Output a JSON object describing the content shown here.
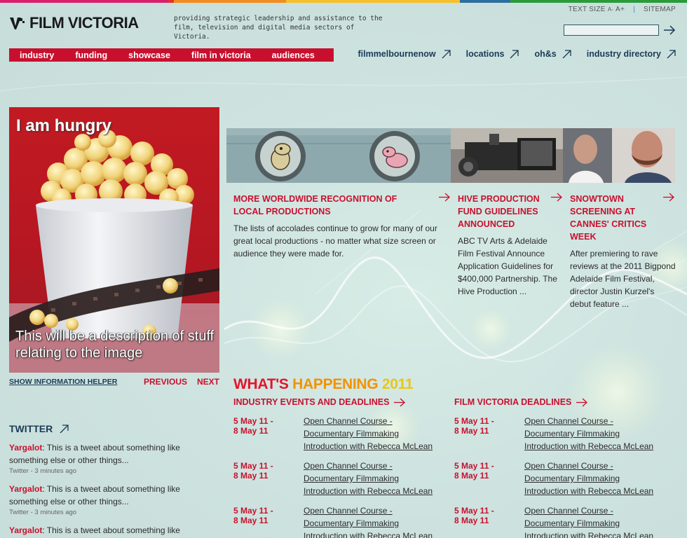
{
  "colors": {
    "brand_red": "#c8102e",
    "nav_blue": "#1b3b57",
    "strip": [
      "#d9206e",
      "#e6302a",
      "#f28c1e",
      "#f6c02a",
      "#2c6e9e",
      "#2a9a3c"
    ]
  },
  "brand": {
    "logo_text": "FILM VICTORIA",
    "tagline": "providing strategic leadership and assistance to the film, television and digital media sectors of Victoria."
  },
  "utility": {
    "text_size_label": "TEXT SIZE",
    "smaller": "A-",
    "larger": "A+",
    "sitemap": "SITEMAP",
    "search_placeholder": ""
  },
  "main_nav": [
    "industry",
    "funding",
    "showcase",
    "film in victoria",
    "audiences"
  ],
  "secondary_nav": [
    "filmmelbournenow",
    "locations",
    "oh&s",
    "industry directory"
  ],
  "hero": {
    "title": "I am hungry",
    "description": "This will be a description of stuff relating to the image",
    "helper": "SHOW INFORMATION HELPER",
    "previous": "PREVIOUS",
    "next": "NEXT"
  },
  "news": [
    {
      "title": "MORE WORLDWIDE RECOGNITION OF LOCAL PRODUCTIONS",
      "body": "The lists of accolades continue to grow for many of our great local productions - no matter what size screen or audience they were made for."
    },
    {
      "title": "HIVE PRODUCTION FUND GUIDELINES ANNOUNCED",
      "body": "ABC TV Arts & Adelaide Film Festival Announce Application Guidelines for $400,000 Partnership. The Hive Production ..."
    },
    {
      "title": "SNOWTOWN SCREENING AT CANNES' CRITICS WEEK",
      "body": "After premiering to rave reviews at the 2011 Bigpond Adelaide Film Festival, director Justin Kurzel's debut feature ..."
    }
  ],
  "whats_happening": {
    "part1": "WHAT'S",
    "part2": "HAPPENING",
    "part3": "2011",
    "industry_heading": "INDUSTRY EVENTS AND DEADLINES",
    "fv_heading": "FILM VICTORIA DEADLINES",
    "industry_events": [
      {
        "date1": "5 May 11 -",
        "date2": "8 May 11",
        "title": "Open Channel Course - Documentary Filmmaking Introduction with Rebecca McLean"
      },
      {
        "date1": "5 May 11 -",
        "date2": "8 May 11",
        "title": "Open Channel Course - Documentary Filmmaking Introduction with Rebecca McLean"
      },
      {
        "date1": "5 May 11 -",
        "date2": "8 May 11",
        "title": "Open Channel Course - Documentary Filmmaking Introduction with Rebecca McLean"
      }
    ],
    "fv_events": [
      {
        "date1": "5 May 11 -",
        "date2": "8 May 11",
        "title": "Open Channel Course - Documentary Filmmaking Introduction with Rebecca McLean"
      },
      {
        "date1": "5 May 11 -",
        "date2": "8 May 11",
        "title": "Open Channel Course - Documentary Filmmaking Introduction with Rebecca McLean"
      },
      {
        "date1": "5 May 11 -",
        "date2": "8 May 11",
        "title": "Open Channel Course - Documentary Filmmaking Introduction with Rebecca McLean"
      }
    ]
  },
  "twitter": {
    "title": "TWITTER",
    "tweets": [
      {
        "user": "Yargalot",
        "text": ": This is a tweet about something like something else or other things...",
        "meta": "Twitter - 3 minutes ago"
      },
      {
        "user": "Yargalot",
        "text": ": This is a tweet about something like something else or other things...",
        "meta": "Twitter - 3 minutes ago"
      },
      {
        "user": "Yargalot",
        "text": ": This is a tweet about something like",
        "meta": ""
      }
    ]
  }
}
